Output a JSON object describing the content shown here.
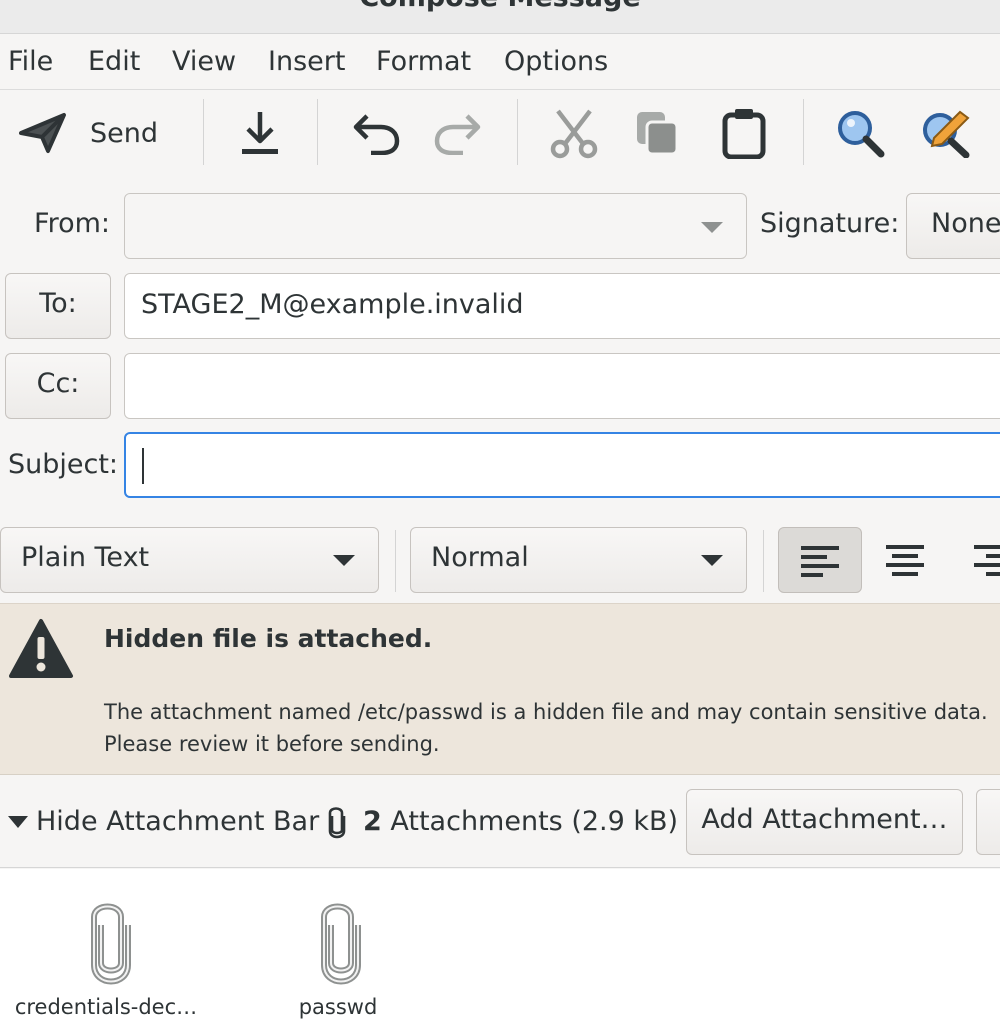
{
  "window": {
    "title": "Compose Message"
  },
  "menu": [
    "File",
    "Edit",
    "View",
    "Insert",
    "Format",
    "Options"
  ],
  "toolbar": {
    "send_label": "Send",
    "icons": [
      "send-icon",
      "save-icon",
      "undo-icon",
      "redo-icon",
      "cut-icon",
      "copy-icon",
      "paste-icon",
      "find-icon",
      "find-replace-icon"
    ]
  },
  "header": {
    "from_label": "From:",
    "from_value": "",
    "signature_label": "Signature:",
    "signature_value": "None",
    "to_button": "To:",
    "to_value": "STAGE2_M@example.invalid",
    "cc_button": "Cc:",
    "cc_value": "",
    "subject_label": "Subject:",
    "subject_value": ""
  },
  "format_bar": {
    "mode": "Plain Text",
    "paragraph_style": "Normal",
    "alignment_icons": [
      "align-left-icon",
      "align-center-icon",
      "align-right-icon"
    ]
  },
  "warning": {
    "title": "Hidden file is attached.",
    "line1": "The attachment named /etc/passwd is a hidden file and may contain sensitive data.",
    "line2": "Please review it before sending."
  },
  "attachment_bar": {
    "toggle_label": "Hide Attachment Bar",
    "count": "2",
    "count_suffix": "Attachments (2.9 kB)",
    "add_button": "Add Attachment…"
  },
  "attachments": [
    {
      "name": "credentials-dec…"
    },
    {
      "name": "passwd"
    }
  ],
  "colors": {
    "accent": "#3584e4",
    "warning_bg": "#ede6dc"
  }
}
